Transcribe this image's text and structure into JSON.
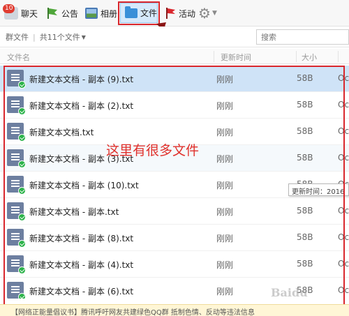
{
  "toolbar": {
    "chat": {
      "label": "聊天",
      "badge": "10"
    },
    "notice": {
      "label": "公告"
    },
    "album": {
      "label": "相册"
    },
    "file": {
      "label": "文件"
    },
    "activity": {
      "label": "活动"
    },
    "settings_icon": "gear-icon"
  },
  "filter": {
    "group_files": "群文件",
    "separator": "|",
    "count": "共11个文件"
  },
  "search": {
    "placeholder": "搜索"
  },
  "table": {
    "headers": {
      "name": "文件名",
      "time": "更新时间",
      "size": "大小"
    },
    "rows": [
      {
        "name": "新建文本文档 - 副本 (9).txt",
        "time": "刚刚",
        "size": "58B",
        "extra": "Oc"
      },
      {
        "name": "新建文本文档 - 副本 (2).txt",
        "time": "刚刚",
        "size": "58B",
        "extra": "Oc"
      },
      {
        "name": "新建文本文档.txt",
        "time": "刚刚",
        "size": "58B",
        "extra": "Oc"
      },
      {
        "name": "新建文本文档 - 副本 (3).txt",
        "time": "刚刚",
        "size": "58B",
        "extra": "Oc"
      },
      {
        "name": "新建文本文档 - 副本 (10).txt",
        "time": "刚刚",
        "size": "58B",
        "extra": "Oc"
      },
      {
        "name": "新建文本文档 - 副本.txt",
        "time": "刚刚",
        "size": "58B",
        "extra": "Oc"
      },
      {
        "name": "新建文本文档 - 副本 (8).txt",
        "time": "刚刚",
        "size": "58B",
        "extra": "Oc"
      },
      {
        "name": "新建文本文档 - 副本 (4).txt",
        "time": "刚刚",
        "size": "58B",
        "extra": "Oc"
      },
      {
        "name": "新建文本文档 - 副本 (6).txt",
        "time": "刚刚",
        "size": "58B",
        "extra": "Oc"
      }
    ]
  },
  "annotation": "这里有很多文件",
  "tooltip": "更新时间：2016",
  "banner": "【网络正能量倡议书】腾讯呼吁网友共建绿色QQ群 抵制色情、反动等违法信息",
  "watermark": "Baidu",
  "colors": {
    "highlight": "#d9262c",
    "selected_row": "#cfe3f7",
    "accent": "#3a8fd8"
  }
}
